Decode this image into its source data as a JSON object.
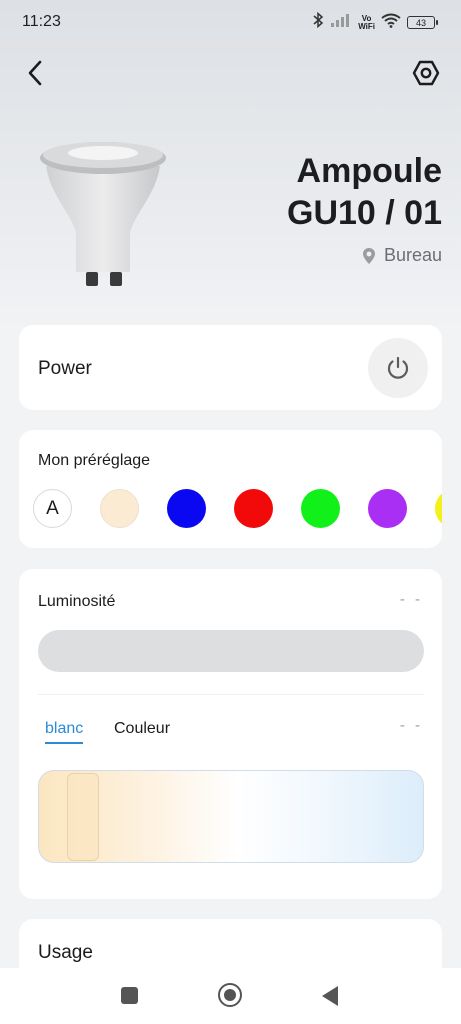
{
  "status_bar": {
    "time": "11:23",
    "vowifi": [
      "Vo",
      "WiFi"
    ],
    "battery": "43"
  },
  "nav": {
    "back_icon": "chevron-left-icon",
    "settings_icon": "hexagon-settings-icon"
  },
  "device": {
    "name_line1": "Ampoule",
    "name_line2": "GU10 / 01",
    "location": "Bureau",
    "location_icon": "map-pin-icon"
  },
  "power": {
    "label": "Power",
    "icon": "power-icon"
  },
  "preset": {
    "title": "Mon préréglage",
    "auto_label": "A",
    "swatches": [
      "#fcebd3",
      "#0a08f0",
      "#f20a0a",
      "#12f01a",
      "#a92ff5",
      "#f3f01c"
    ]
  },
  "brightness": {
    "title": "Luminosité",
    "value": "- -"
  },
  "color_mode": {
    "tabs": [
      "blanc",
      "Couleur"
    ],
    "active_tab": "blanc",
    "value": "- -",
    "accent": "#2a8bd8"
  },
  "usage": {
    "title": "Usage"
  }
}
